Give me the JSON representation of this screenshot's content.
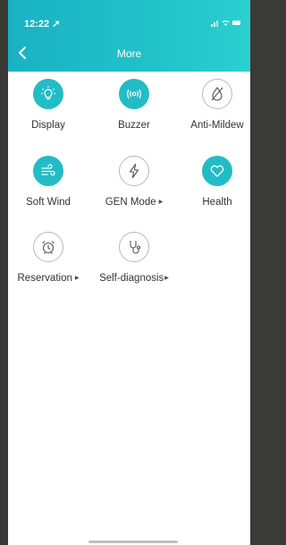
{
  "status_bar": {
    "time": "12:22 ➚"
  },
  "header": {
    "title": "More"
  },
  "features": [
    {
      "label": "Display",
      "icon": "light-bulb-icon",
      "state": "on"
    },
    {
      "label": "Buzzer",
      "icon": "sound-waves-icon",
      "state": "on"
    },
    {
      "label": "Anti-Mildew",
      "icon": "droplet-slash-icon",
      "state": "off"
    },
    {
      "label": "Soft Wind",
      "icon": "wind-icon",
      "state": "on"
    },
    {
      "label": "GEN Mode",
      "icon": "lightning-icon",
      "state": "off",
      "has_arrow": true
    },
    {
      "label": "Health",
      "icon": "heart-icon",
      "state": "on"
    },
    {
      "label": "Reservation",
      "icon": "alarm-clock-icon",
      "state": "off",
      "has_arrow": true
    },
    {
      "label": "Self-diagnosis",
      "icon": "stethoscope-icon",
      "state": "off",
      "has_arrow": true
    }
  ],
  "colors": {
    "accent": "#22bcc7",
    "header_start": "#19b2c3",
    "header_end": "#2ad0cf"
  }
}
